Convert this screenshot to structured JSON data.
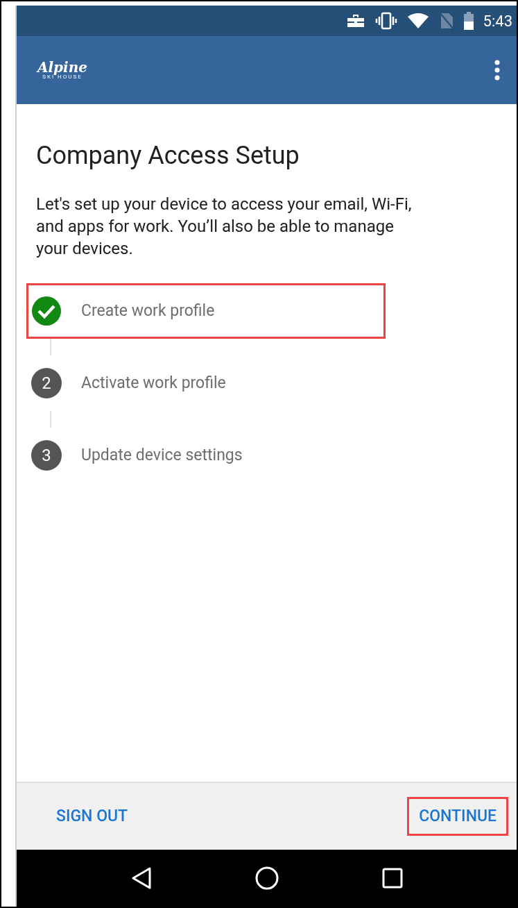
{
  "status_bar": {
    "time": "5:43"
  },
  "app_bar": {
    "logo": {
      "title": "Alpine",
      "subtitle_left": "SKI",
      "subtitle_right": "HOUSE"
    }
  },
  "title": "Company Access Setup",
  "description": "Let's set up your device to access your email, Wi-Fi, and apps for work. You’ll also be able to manage your devices.",
  "steps": [
    {
      "label": "Create work profile",
      "done": true,
      "highlighted": true
    },
    {
      "label": "Activate work profile",
      "number": "2",
      "done": false,
      "highlighted": false
    },
    {
      "label": "Update device settings",
      "number": "3",
      "done": false,
      "highlighted": false
    }
  ],
  "footer": {
    "buttons": [
      {
        "label": "SIGN OUT",
        "highlighted": false
      },
      {
        "label": "CONTINUE",
        "highlighted": true
      }
    ]
  }
}
